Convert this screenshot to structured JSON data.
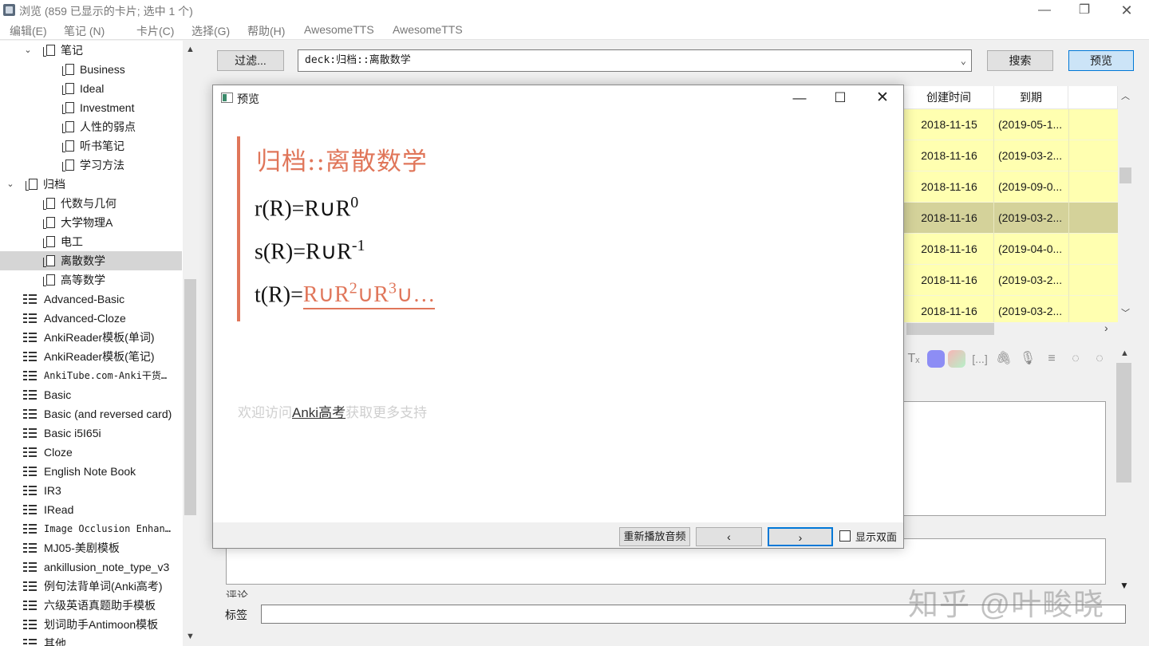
{
  "window": {
    "title": "浏览 (859 已显示的卡片; 选中 1 个)"
  },
  "menubar": {
    "items": [
      "编辑(E)",
      "笔记 (N)",
      "卡片(C)",
      "选择(G)",
      "帮助(H)",
      "AwesomeTTS",
      "AwesomeTTS"
    ]
  },
  "sidebar": {
    "items": [
      {
        "label": "笔记",
        "type": "deck",
        "level": 1,
        "expanded": true
      },
      {
        "label": "Business",
        "type": "deck",
        "level": 2
      },
      {
        "label": "Ideal",
        "type": "deck",
        "level": 2
      },
      {
        "label": "Investment",
        "type": "deck",
        "level": 2
      },
      {
        "label": "人性的弱点",
        "type": "deck",
        "level": 2
      },
      {
        "label": "听书笔记",
        "type": "deck",
        "level": 2
      },
      {
        "label": "学习方法",
        "type": "deck",
        "level": 2
      },
      {
        "label": "归档",
        "type": "deck",
        "level": 0,
        "expanded": true
      },
      {
        "label": "代数与几何",
        "type": "deck",
        "level": 1
      },
      {
        "label": "大学物理A",
        "type": "deck",
        "level": 1
      },
      {
        "label": "电工",
        "type": "deck",
        "level": 1
      },
      {
        "label": "离散数学",
        "type": "deck",
        "level": 1,
        "selected": true
      },
      {
        "label": "高等数学",
        "type": "deck",
        "level": 1
      },
      {
        "label": "Advanced-Basic",
        "type": "notetype"
      },
      {
        "label": "Advanced-Cloze",
        "type": "notetype"
      },
      {
        "label": "AnkiReader模板(单词)",
        "type": "notetype"
      },
      {
        "label": "AnkiReader模板(笔记)",
        "type": "notetype"
      },
      {
        "label": "AnkiTube.com-Anki干货…",
        "type": "notetype",
        "mono": true
      },
      {
        "label": "Basic",
        "type": "notetype"
      },
      {
        "label": "Basic (and reversed card)",
        "type": "notetype"
      },
      {
        "label": "Basic i5I65i",
        "type": "notetype"
      },
      {
        "label": "Cloze",
        "type": "notetype"
      },
      {
        "label": "English Note Book",
        "type": "notetype"
      },
      {
        "label": "IR3",
        "type": "notetype"
      },
      {
        "label": "IRead",
        "type": "notetype"
      },
      {
        "label": "Image Occlusion Enhan…",
        "type": "notetype",
        "mono": true
      },
      {
        "label": "MJ05-美剧模板",
        "type": "notetype"
      },
      {
        "label": "ankillusion_note_type_v3",
        "type": "notetype"
      },
      {
        "label": "例句法背单词(Anki高考)",
        "type": "notetype"
      },
      {
        "label": "六级英语真题助手模板",
        "type": "notetype"
      },
      {
        "label": "划词助手Antimoon模板",
        "type": "notetype"
      },
      {
        "label": "其他",
        "type": "notetype"
      }
    ]
  },
  "toolbar": {
    "filter_label": "过滤...",
    "deck_query": "deck:归档::离散数学",
    "search_label": "搜索",
    "preview_label": "预览"
  },
  "table": {
    "columns": [
      "创建时间",
      "到期"
    ],
    "rows": [
      {
        "created": "2018-11-15",
        "due": "(2019-05-1..."
      },
      {
        "created": "2018-11-16",
        "due": "(2019-03-2..."
      },
      {
        "created": "2018-11-16",
        "due": "(2019-09-0..."
      },
      {
        "created": "2018-11-16",
        "due": "(2019-03-2...",
        "selected": true
      },
      {
        "created": "2018-11-16",
        "due": "(2019-04-0..."
      },
      {
        "created": "2018-11-16",
        "due": "(2019-03-2..."
      },
      {
        "created": "2018-11-16",
        "due": "(2019-03-2..."
      }
    ]
  },
  "editor": {
    "comment_label": "评论",
    "tags_label": "标签",
    "tags_value": ""
  },
  "preview": {
    "title": "预览",
    "card_title": "归档::离散数学",
    "lines": {
      "r_prefix": "r(R)=R∪R",
      "r_sup": "0",
      "s_prefix": "s(R)=R∪R",
      "s_sup": "-1",
      "t_prefix": "t(R)=",
      "t_a": "R∪R",
      "t_sup1": "2",
      "t_b": "∪R",
      "t_sup2": "3",
      "t_c": "∪…"
    },
    "promo_before": "欢迎访问",
    "promo_link": "Anki高考",
    "promo_after": "获取更多支持",
    "replay_label": "重新播放音频",
    "prev_label": "‹",
    "next_label": "›",
    "show_both_label": "显示双面",
    "show_both_checked": false
  },
  "watermark": "知乎 @叶畯晓",
  "colors": {
    "accent": "#e0765a",
    "row_bg": "#ffffb0",
    "row_selected": "#d4d29a",
    "button_primary": "#cce4f7"
  }
}
